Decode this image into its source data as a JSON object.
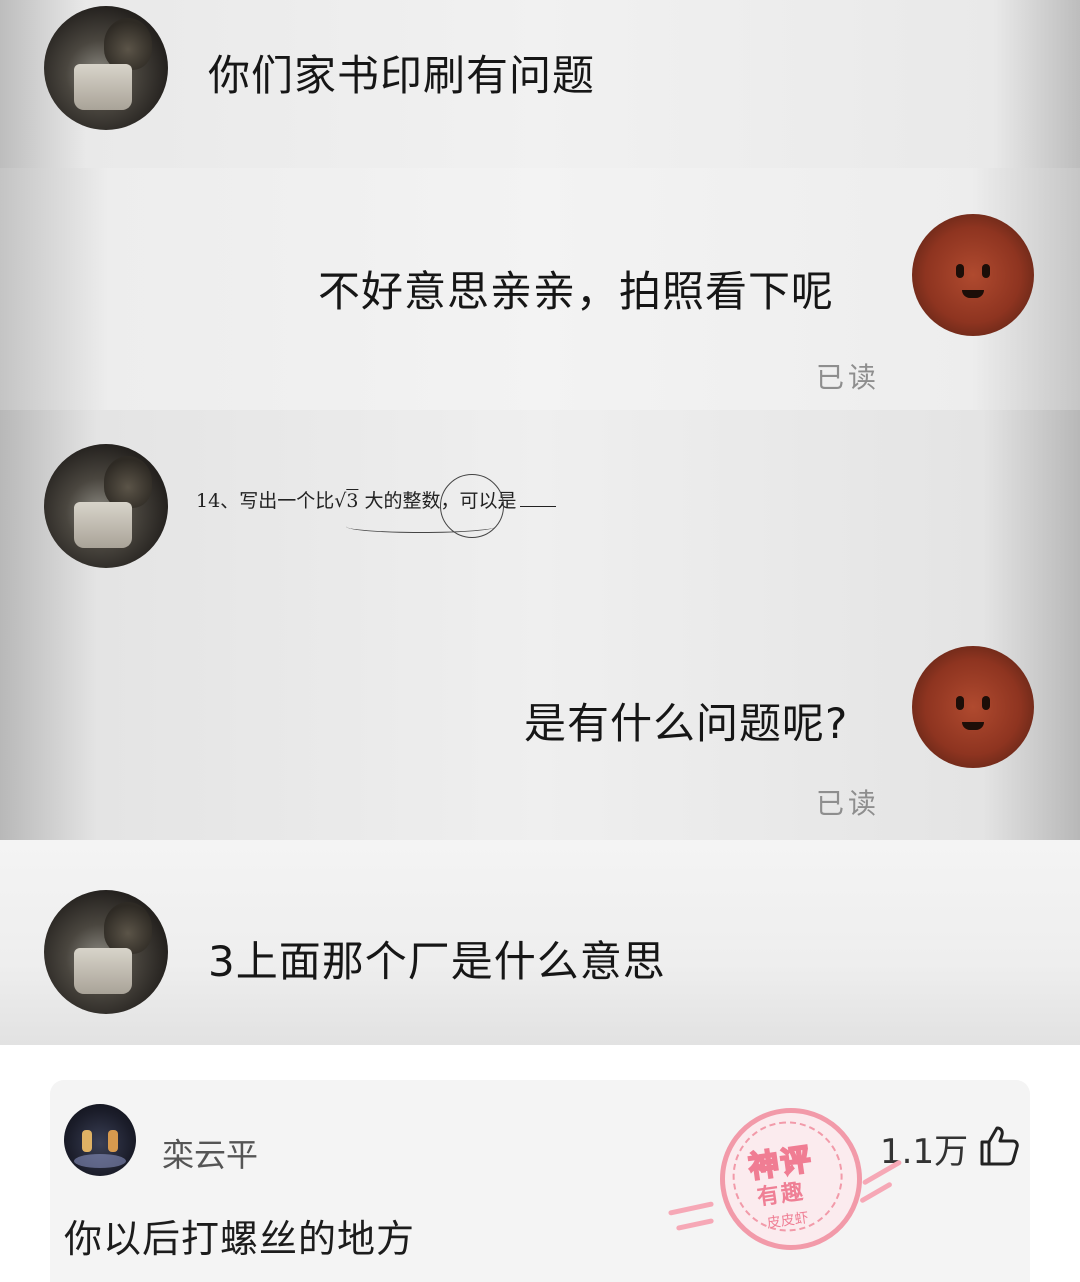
{
  "chat": {
    "msg1": "你们家书印刷有问题",
    "msg2": "不好意思亲亲，拍照看下呢",
    "msg2_status": "已读",
    "problem": {
      "number": "14、",
      "pre": "写出一个比",
      "radical": "√",
      "radicand": "3",
      "post": " 大的整数，可以是"
    },
    "msg3": "是有什么问题呢?",
    "msg3_status": "已读",
    "msg4": "3上面那个厂是什么意思"
  },
  "comment": {
    "username": "栾云平",
    "text": "你以后打螺丝的地方",
    "likes": "1.1万"
  },
  "stamp": {
    "line1": "神评",
    "line2": "有趣",
    "line3": "皮皮虾"
  },
  "colors": {
    "stamp_pink": "#f29aa9",
    "avatar_orange": "#8e3420"
  }
}
